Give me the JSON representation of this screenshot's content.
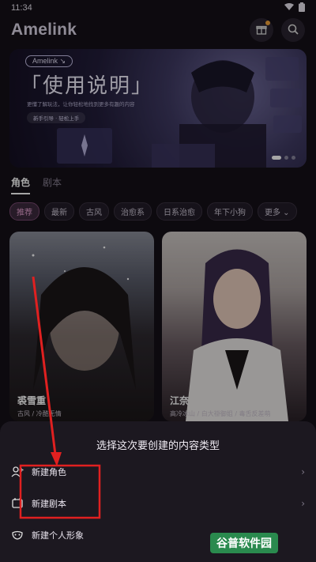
{
  "status": {
    "time": "11:34"
  },
  "header": {
    "logo": "Amelink"
  },
  "banner": {
    "tag": "Amelink ↘",
    "title": "「使用说明」",
    "subtitle": "更懂了解玩法，让你轻松地找到更多有趣的内容",
    "pill": "新手引导 · 轻松上手"
  },
  "tabs": [
    {
      "label": "角色",
      "active": true
    },
    {
      "label": "剧本",
      "active": false
    }
  ],
  "filters": [
    "推荐",
    "最新",
    "古风",
    "治愈系",
    "日系治愈",
    "年下小狗",
    "更多 ⌄"
  ],
  "cards": [
    {
      "name": "裘雪重",
      "tags": "古风 / 冷酷无情"
    },
    {
      "name": "江奈",
      "tags": "高冷冰山 / 白大褂御姐 / 毒舌反差萌"
    }
  ],
  "sheet": {
    "title": "选择这次要创建的内容类型",
    "items": [
      {
        "label": "新建角色",
        "icon": "add-person-icon"
      },
      {
        "label": "新建剧本",
        "icon": "script-icon"
      },
      {
        "label": "新建个人形象",
        "icon": "mask-icon"
      }
    ]
  },
  "watermark": "谷普软件园"
}
